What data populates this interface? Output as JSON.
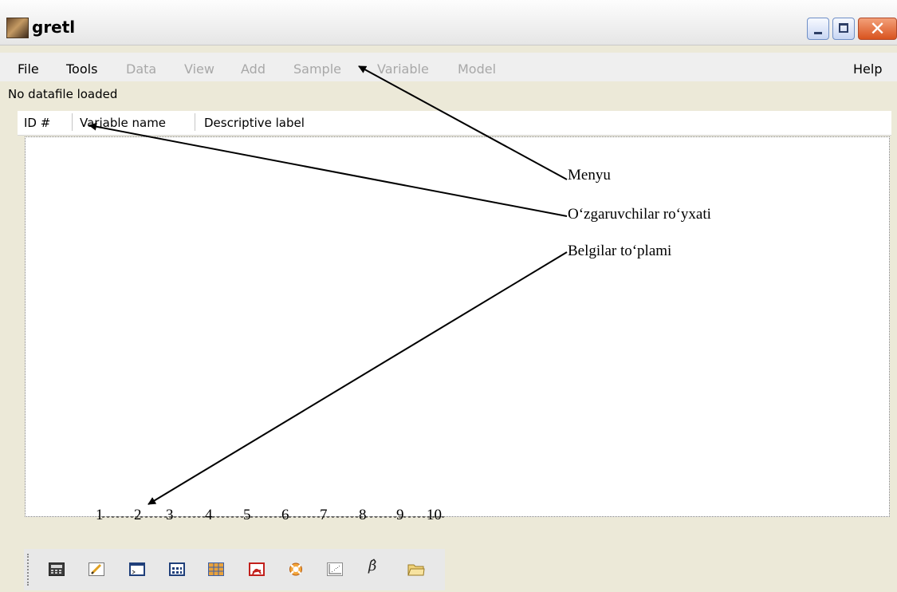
{
  "window": {
    "title": "gretl"
  },
  "menu": {
    "items": [
      {
        "label": "File",
        "disabled": false
      },
      {
        "label": "Tools",
        "disabled": false
      },
      {
        "label": "Data",
        "disabled": true
      },
      {
        "label": "View",
        "disabled": true
      },
      {
        "label": "Add",
        "disabled": true
      },
      {
        "label": "Sample",
        "disabled": true
      },
      {
        "label": "Variable",
        "disabled": true
      },
      {
        "label": "Model",
        "disabled": true
      }
    ],
    "help": "Help"
  },
  "status_text": "No datafile loaded",
  "columns": [
    "ID #",
    "Variable name",
    "Descriptive label"
  ],
  "annotations": {
    "menu": "Menyu",
    "variables": "O‘zgaruvchilar ro‘yxati",
    "toolbar": "Belgilar to‘plami"
  },
  "icon_numbers": [
    "1",
    "2",
    "3",
    "4",
    "5",
    "6",
    "7",
    "8",
    "9",
    "10"
  ],
  "toolbar_icons": [
    "calculator-icon",
    "edit-script-icon",
    "console-icon",
    "session-icon",
    "table-icon",
    "pdf-guide-icon",
    "help-icon",
    "graph-icon",
    "beta-hat-icon",
    "folder-open-icon"
  ],
  "beta_symbol": "β̂",
  "colors": {
    "close_button": "#d9531e",
    "disabled_menu": "#a8a8a8"
  }
}
